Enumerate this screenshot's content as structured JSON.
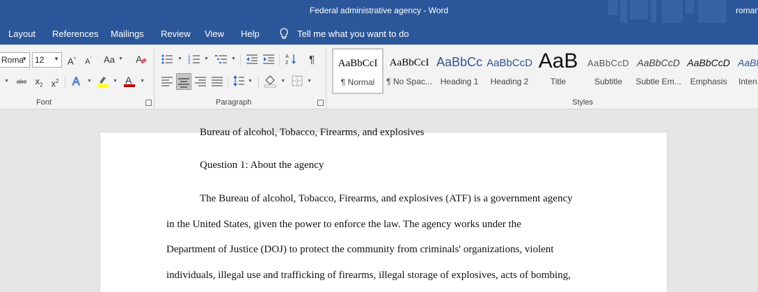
{
  "window": {
    "title": "Federal administrative agency  -  Word",
    "user": "roman"
  },
  "menu": {
    "tabs": [
      "Layout",
      "References",
      "Mailings",
      "Review",
      "View",
      "Help"
    ],
    "tell_me": "Tell me what you want to do"
  },
  "ribbon": {
    "font": {
      "label": "Font",
      "name": "Roma",
      "size": "12",
      "change_case": "Aa",
      "strikethrough": "abc",
      "subscript": "x",
      "subscript_mark": "2",
      "superscript": "x",
      "superscript_mark": "2",
      "highlight_color": "#ffff00",
      "font_color": "#c00000"
    },
    "paragraph": {
      "label": "Paragraph"
    },
    "styles": {
      "label": "Styles",
      "items": [
        {
          "preview": "AaBbCcI",
          "name": "¶ Normal",
          "selected": true
        },
        {
          "preview": "AaBbCcI",
          "name": "¶ No Spac..."
        },
        {
          "preview": "AaBbCc",
          "name": "Heading 1",
          "color": "#2f5496"
        },
        {
          "preview": "AaBbCcD",
          "name": "Heading 2",
          "color": "#2f5496"
        },
        {
          "preview": "AaB",
          "name": "Title"
        },
        {
          "preview": "AaBbCcD",
          "name": "Subtitle",
          "color": "#595959"
        },
        {
          "preview": "AaBbCcD",
          "name": "Subtle Em...",
          "color": "#404040"
        },
        {
          "preview": "AaBbCcD",
          "name": "Emphasis"
        },
        {
          "preview": "AaBl",
          "name": "Inten",
          "color": "#2f5496"
        }
      ]
    }
  },
  "document": {
    "lines": [
      "Bureau of alcohol, Tobacco, Firearms, and explosives",
      "Question 1: About the agency",
      "The Bureau of alcohol, Tobacco, Firearms, and explosives (ATF) is a government agency",
      "in the United States, given the power to enforce the law. The agency works under the",
      "Department of Justice (DOJ) to protect the community from criminals' organizations, violent",
      "individuals, illegal use and trafficking of firearms, illegal storage of explosives, acts of bombing,"
    ]
  }
}
